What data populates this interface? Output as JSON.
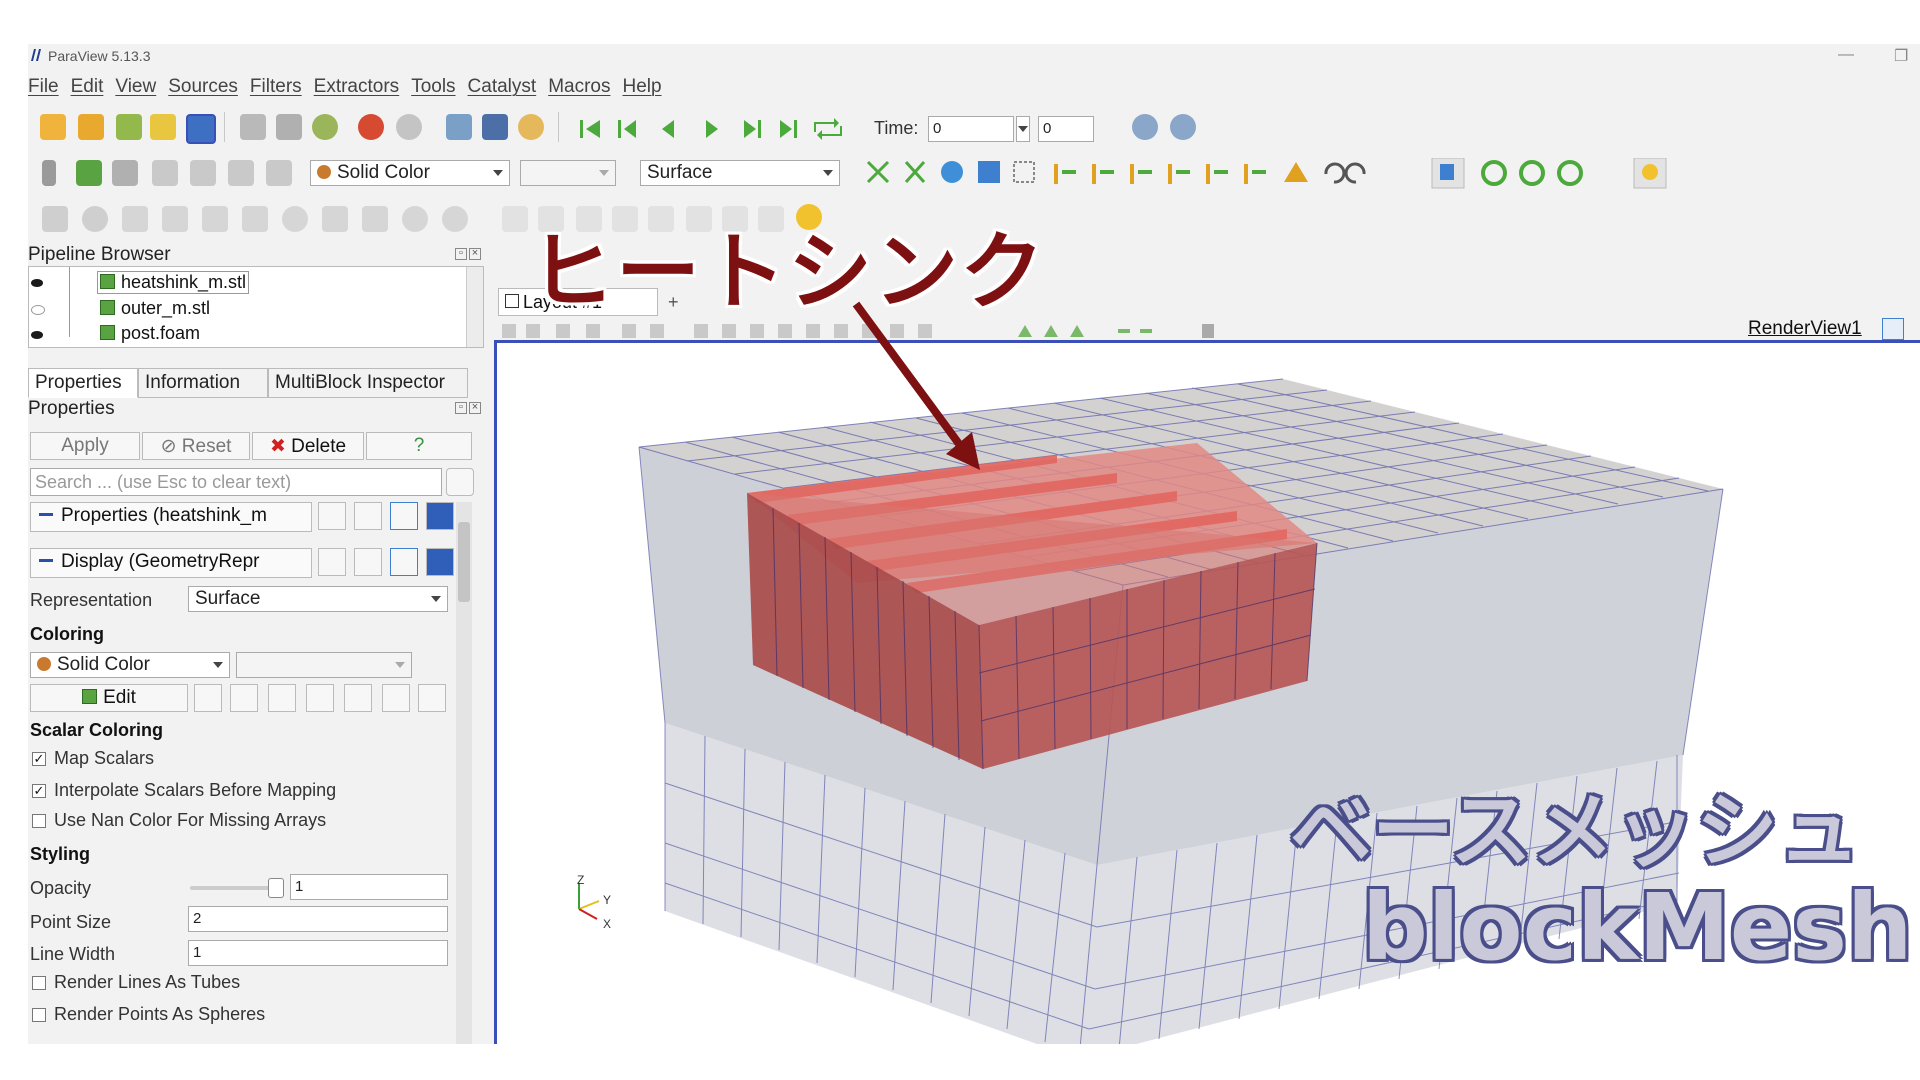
{
  "window": {
    "title": "ParaView 5.13.3",
    "minimize": "—",
    "restore": "❐"
  },
  "menu": [
    "File",
    "Edit",
    "View",
    "Sources",
    "Filters",
    "Extractors",
    "Tools",
    "Catalyst",
    "Macros",
    "Help"
  ],
  "toolbar1": {
    "time_label": "Time:",
    "time_value": "0",
    "step_value": "0"
  },
  "toolbar2": {
    "color_combo": "Solid Color",
    "representation_combo": "Surface"
  },
  "pipeline": {
    "title": "Pipeline Browser",
    "items": [
      {
        "label": "heatshink_m.stl",
        "visible": true
      },
      {
        "label": "outer_m.stl",
        "visible": false
      },
      {
        "label": "post.foam",
        "visible": true
      }
    ]
  },
  "tabs": [
    "Properties",
    "Information",
    "MultiBlock Inspector"
  ],
  "properties": {
    "title": "Properties",
    "apply": "Apply",
    "reset": "Reset",
    "delete": "Delete",
    "help": "?",
    "search_placeholder": "Search ... (use Esc to clear text)",
    "section_properties": "Properties (heatshink_m",
    "section_display": "Display (GeometryRepr",
    "representation_label": "Representation",
    "representation_value": "Surface",
    "coloring_header": "Coloring",
    "coloring_value": "Solid Color",
    "edit_label": "Edit",
    "scalar_coloring_header": "Scalar Coloring",
    "checkboxes": [
      {
        "label": "Map Scalars",
        "checked": true
      },
      {
        "label": "Interpolate Scalars Before Mapping",
        "checked": true
      },
      {
        "label": "Use Nan Color For Missing Arrays",
        "checked": false
      }
    ],
    "styling_header": "Styling",
    "opacity_label": "Opacity",
    "opacity_value": "1",
    "point_size_label": "Point Size",
    "point_size_value": "2",
    "line_width_label": "Line Width",
    "line_width_value": "1",
    "render_checkboxes": [
      {
        "label": "Render Lines As Tubes",
        "checked": false
      },
      {
        "label": "Render Points As Spheres",
        "checked": false
      }
    ]
  },
  "view": {
    "layout_tab": "Layout #1",
    "render_view_label": "RenderView1",
    "axes": {
      "z": "Z",
      "y": "Y",
      "x": "X"
    }
  },
  "annotations": {
    "heatsink": "ヒートシンク",
    "base_mesh": "ベースメッシュ",
    "blockmesh": "blockMesh"
  },
  "colors": {
    "accent": "#3b4fb8",
    "annotation_red": "#7d1010",
    "mesh_line": "#4a4e9a",
    "heatsink_fill": "#d0504a"
  }
}
